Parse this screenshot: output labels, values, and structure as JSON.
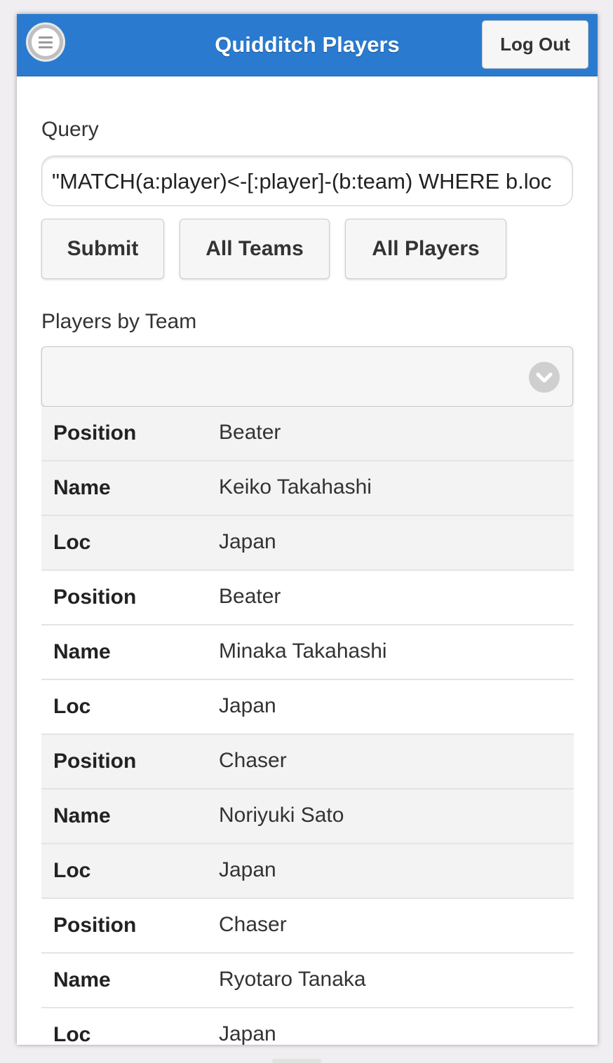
{
  "header": {
    "title": "Quidditch Players",
    "logout_label": "Log Out",
    "menu_icon": "hamburger-menu-icon"
  },
  "query": {
    "label": "Query",
    "value": "\"MATCH(a:player)<-[:player]-(b:team) WHERE b.loc"
  },
  "buttons": {
    "submit": "Submit",
    "all_teams": "All Teams",
    "all_players": "All Players"
  },
  "players_by_team": {
    "label": "Players by Team",
    "selected": "",
    "icon": "chevron-down-icon"
  },
  "rows": [
    {
      "key": "Position",
      "value": "Beater"
    },
    {
      "key": "Name",
      "value": "Keiko Takahashi"
    },
    {
      "key": "Loc",
      "value": "Japan"
    },
    {
      "key": "Position",
      "value": "Beater"
    },
    {
      "key": "Name",
      "value": "Minaka Takahashi"
    },
    {
      "key": "Loc",
      "value": "Japan"
    },
    {
      "key": "Position",
      "value": "Chaser"
    },
    {
      "key": "Name",
      "value": "Noriyuki Sato"
    },
    {
      "key": "Loc",
      "value": "Japan"
    },
    {
      "key": "Position",
      "value": "Chaser"
    },
    {
      "key": "Name",
      "value": "Ryotaro Tanaka"
    },
    {
      "key": "Loc",
      "value": "Japan"
    }
  ],
  "colors": {
    "header_bg": "#2a7bd0",
    "row_shade": "#f3f3f3"
  }
}
